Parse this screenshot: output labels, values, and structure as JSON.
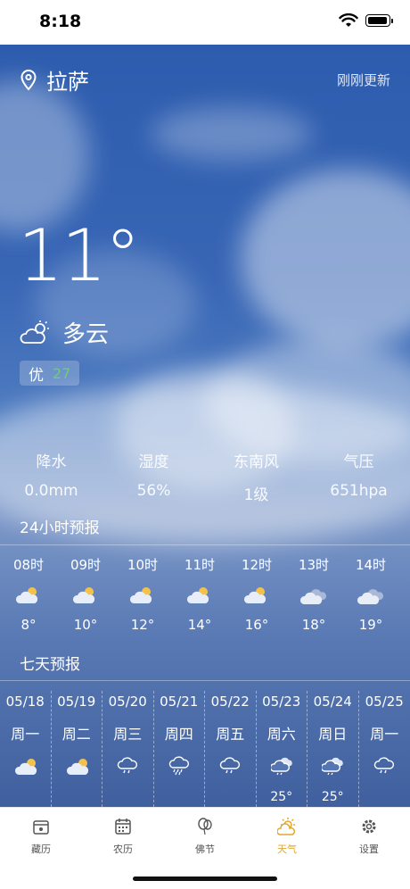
{
  "status_bar": {
    "time": "8:18"
  },
  "header": {
    "city": "拉萨",
    "update_status": "刚刚更新"
  },
  "current": {
    "temperature": "11°",
    "condition": "多云",
    "aqi_level": "优",
    "aqi_value": "27"
  },
  "stats": [
    {
      "label": "降水",
      "value": "0.0mm"
    },
    {
      "label": "湿度",
      "value": "56%"
    },
    {
      "label": "东南风",
      "value": "1级"
    },
    {
      "label": "气压",
      "value": "651hpa"
    }
  ],
  "hourly_title": "24小时预报",
  "hourly": [
    {
      "time": "08时",
      "temp": "8°",
      "icon": "partly-sunny-icon"
    },
    {
      "time": "09时",
      "temp": "10°",
      "icon": "partly-sunny-icon"
    },
    {
      "time": "10时",
      "temp": "12°",
      "icon": "partly-sunny-icon"
    },
    {
      "time": "11时",
      "temp": "14°",
      "icon": "partly-sunny-icon"
    },
    {
      "time": "12时",
      "temp": "16°",
      "icon": "partly-sunny-icon"
    },
    {
      "time": "13时",
      "temp": "18°",
      "icon": "cloudy-icon"
    },
    {
      "time": "14时",
      "temp": "19°",
      "icon": "cloudy-icon"
    }
  ],
  "weekly_title": "七天预报",
  "weekly": [
    {
      "date": "05/18",
      "weekday": "周一",
      "icon": "partly-sunny-icon",
      "temp": ""
    },
    {
      "date": "05/19",
      "weekday": "周二",
      "icon": "partly-sunny-icon",
      "temp": ""
    },
    {
      "date": "05/20",
      "weekday": "周三",
      "icon": "rain-icon",
      "temp": ""
    },
    {
      "date": "05/21",
      "weekday": "周四",
      "icon": "heavy-rain-icon",
      "temp": ""
    },
    {
      "date": "05/22",
      "weekday": "周五",
      "icon": "rain-icon",
      "temp": ""
    },
    {
      "date": "05/23",
      "weekday": "周六",
      "icon": "cloud-rain-icon",
      "temp": "25°"
    },
    {
      "date": "05/24",
      "weekday": "周日",
      "icon": "cloud-rain-icon",
      "temp": "25°"
    },
    {
      "date": "05/25",
      "weekday": "周一",
      "icon": "rain-icon",
      "temp": ""
    }
  ],
  "tabbar": [
    {
      "label": "藏历",
      "icon": "calendar-box-icon",
      "active": false
    },
    {
      "label": "农历",
      "icon": "calendar-grid-icon",
      "active": false
    },
    {
      "label": "佛节",
      "icon": "balloon-icon",
      "active": false
    },
    {
      "label": "天气",
      "icon": "weather-icon",
      "active": true
    },
    {
      "label": "设置",
      "icon": "gear-icon",
      "active": false
    }
  ],
  "colors": {
    "active_tab": "#e0a82e",
    "aqi_good": "#6cd16c"
  }
}
